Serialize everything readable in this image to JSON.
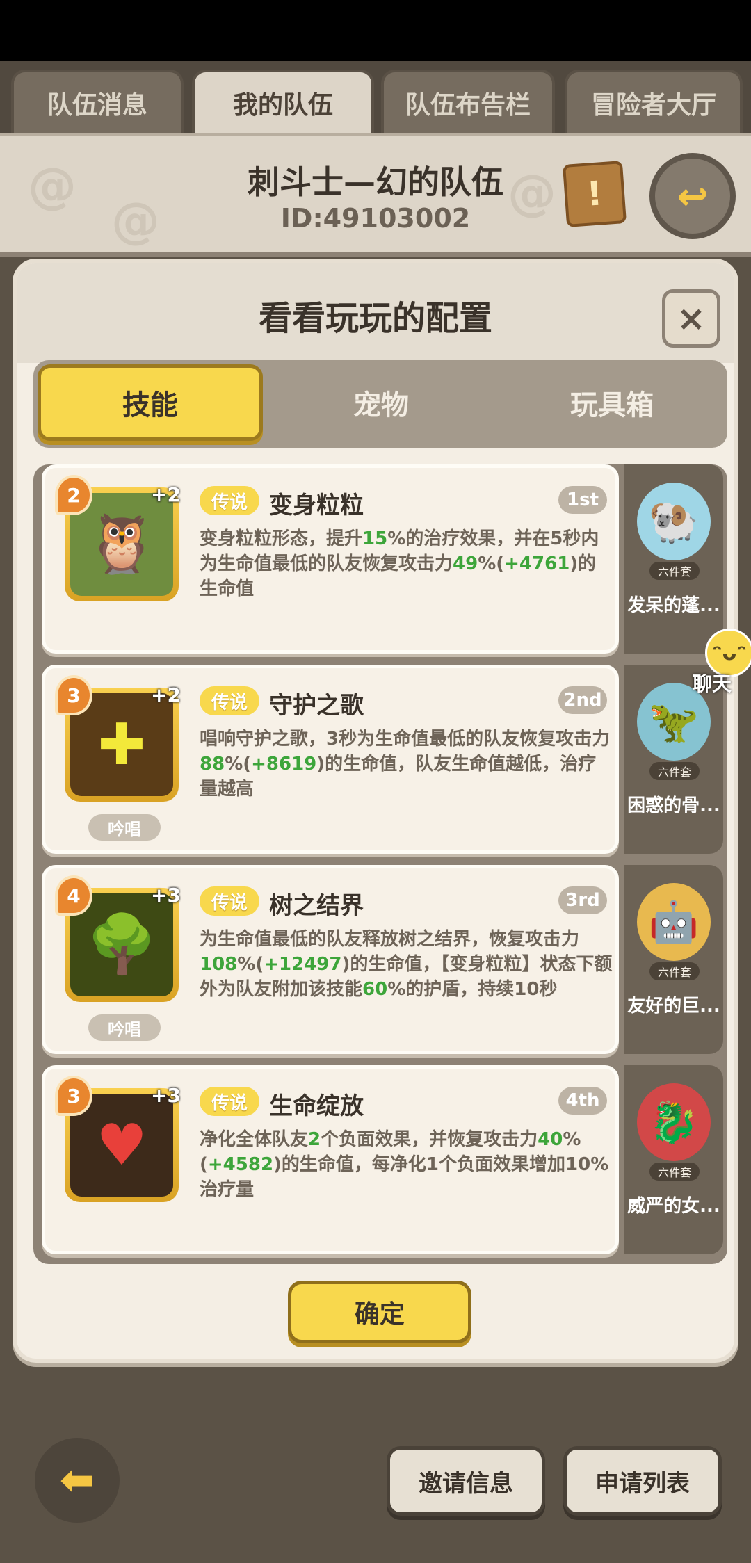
{
  "top_tabs": [
    {
      "label": "队伍消息",
      "active": false
    },
    {
      "label": "我的队伍",
      "active": true
    },
    {
      "label": "队伍布告栏",
      "active": false
    },
    {
      "label": "冒险者大厅",
      "active": false
    }
  ],
  "team": {
    "name": "刺斗士—幻的队伍",
    "id": "ID:49103002"
  },
  "dialog": {
    "title": "看看玩玩的配置",
    "close_symbol": "×",
    "tabs": [
      "技能",
      "宠物",
      "玩具箱"
    ],
    "active_tab": "技能",
    "confirm_label": "确定"
  },
  "skills": [
    {
      "level": "2",
      "plus": "+2",
      "badge": "传说",
      "name": "变身粒粒",
      "rank": "1st",
      "chant": "",
      "icon": "owl-icon",
      "colors": {
        "icon_bg": "#6f8d3f"
      },
      "desc": [
        {
          "t": "变身粒粒形态，提升"
        },
        {
          "t": "15",
          "g": true
        },
        {
          "t": "%的治疗效果，并在5秒内为生命值最低的队友恢复攻击力"
        },
        {
          "t": "49",
          "g": true
        },
        {
          "t": "%("
        },
        {
          "t": "+4761",
          "g": true
        },
        {
          "t": ")的生命值"
        }
      ]
    },
    {
      "level": "3",
      "plus": "+2",
      "badge": "传说",
      "name": "守护之歌",
      "rank": "2nd",
      "chant": "吟唱",
      "icon": "shield-cross-icon",
      "colors": {
        "icon_bg": "#5a3c17"
      },
      "desc": [
        {
          "t": "唱响守护之歌，3秒为生命值最低的队友恢复攻击力"
        },
        {
          "t": "88",
          "g": true
        },
        {
          "t": "%("
        },
        {
          "t": "+8619",
          "g": true
        },
        {
          "t": ")的生命值，队友生命值越低，治疗量越高"
        }
      ]
    },
    {
      "level": "4",
      "plus": "+3",
      "badge": "传说",
      "name": "树之结界",
      "rank": "3rd",
      "chant": "吟唱",
      "icon": "tree-icon",
      "colors": {
        "icon_bg": "#3e4a14"
      },
      "desc": [
        {
          "t": "为生命值最低的队友释放树之结界，恢复攻击力"
        },
        {
          "t": "108",
          "g": true
        },
        {
          "t": "%("
        },
        {
          "t": "+12497",
          "g": true
        },
        {
          "t": ")的生命值，【变身粒粒】状态下额外为队友附加该技能"
        },
        {
          "t": "60",
          "g": true
        },
        {
          "t": "%的护盾，持续10秒"
        }
      ]
    },
    {
      "level": "3",
      "plus": "+3",
      "badge": "传说",
      "name": "生命绽放",
      "rank": "4th",
      "chant": "",
      "icon": "heart-flower-icon",
      "colors": {
        "icon_bg": "#3d2a1a"
      },
      "desc": [
        {
          "t": "净化全体队友"
        },
        {
          "t": "2",
          "g": true
        },
        {
          "t": "个负面效果，并恢复攻击力"
        },
        {
          "t": "40",
          "g": true
        },
        {
          "t": "%("
        },
        {
          "t": "+4582",
          "g": true
        },
        {
          "t": ")的生命值，每净化1个负面效果增加10%治疗量"
        }
      ]
    }
  ],
  "pets": [
    {
      "name": "发呆的蓬...",
      "badge": "六件套",
      "icon": "pet-blue-ram-icon",
      "color": "#9fd6e6"
    },
    {
      "name": "困惑的骨...",
      "badge": "六件套",
      "icon": "pet-blue-dino-icon",
      "color": "#86c3d1"
    },
    {
      "name": "友好的巨...",
      "badge": "六件套",
      "icon": "pet-golem-icon",
      "color": "#e8b94f"
    },
    {
      "name": "威严的女...",
      "badge": "六件套",
      "icon": "pet-red-dragon-icon",
      "color": "#d24848"
    }
  ],
  "chat": {
    "label": "聊天"
  },
  "bottom_buttons": {
    "invite": "邀请信息",
    "apply": "申请列表"
  },
  "colors": {
    "accent_yellow": "#f8d84d",
    "value_green": "#3da53a"
  }
}
